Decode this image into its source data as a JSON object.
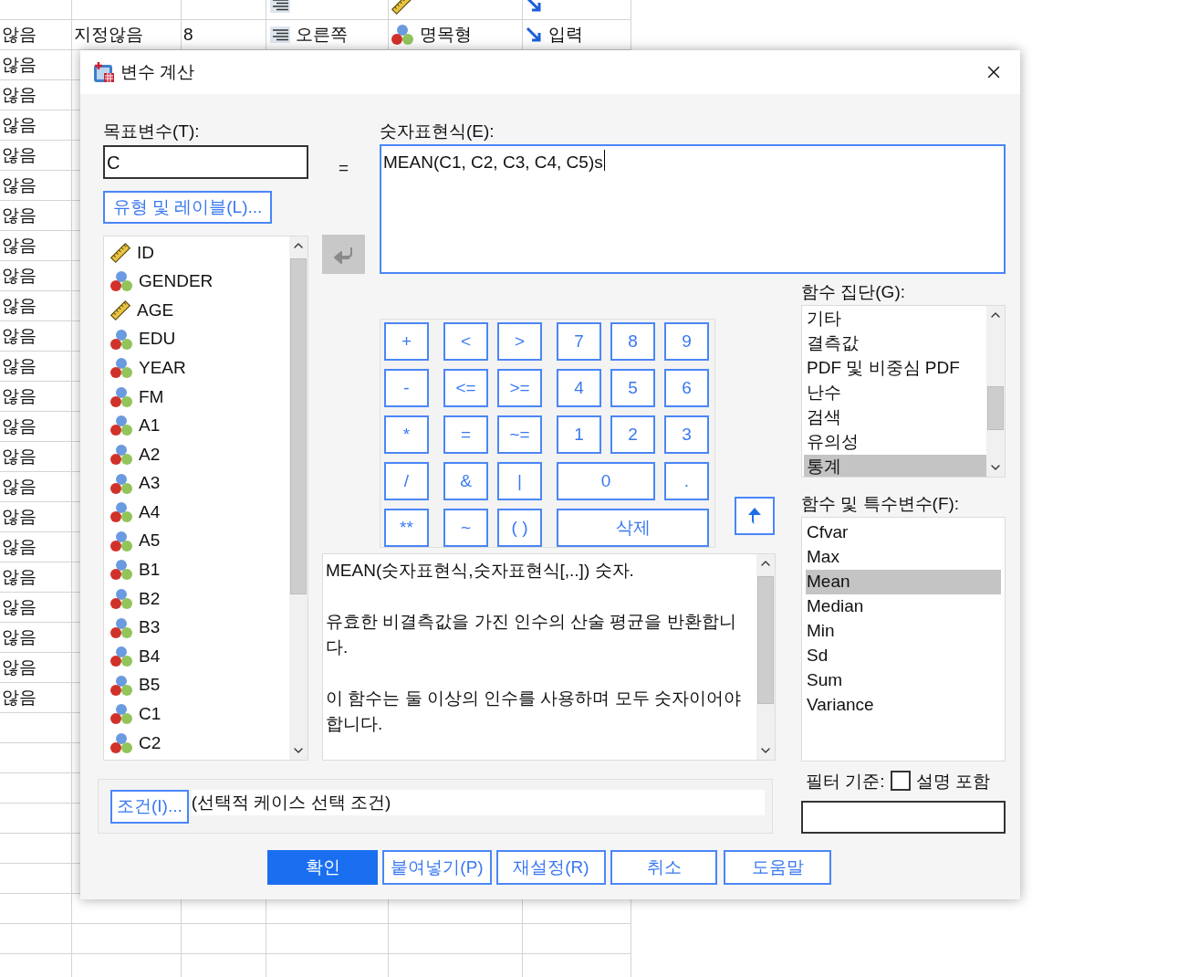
{
  "background_grid": {
    "rows": [
      {
        "kind": "scale"
      },
      {
        "cells": [
          "않음",
          "지정않음",
          "8",
          "오른쪽",
          "명목형",
          "입력"
        ],
        "kind": "nominal"
      },
      {
        "cells": [
          "않음"
        ]
      },
      {
        "cells": [
          "않음"
        ]
      },
      {
        "cells": [
          "않음"
        ]
      },
      {
        "cells": [
          "않음"
        ]
      },
      {
        "cells": [
          "않음"
        ]
      },
      {
        "cells": [
          "않음"
        ]
      },
      {
        "cells": [
          "않음"
        ]
      },
      {
        "cells": [
          "않음"
        ]
      },
      {
        "cells": [
          "않음"
        ]
      },
      {
        "cells": [
          "않음"
        ]
      },
      {
        "cells": [
          "않음"
        ]
      },
      {
        "cells": [
          "않음"
        ]
      },
      {
        "cells": [
          "않음"
        ]
      },
      {
        "cells": [
          "않음"
        ]
      },
      {
        "cells": [
          "않음"
        ]
      },
      {
        "cells": [
          "않음"
        ]
      },
      {
        "cells": [
          "않음"
        ]
      },
      {
        "cells": [
          "않음"
        ]
      },
      {
        "cells": [
          "않음"
        ]
      },
      {
        "cells": [
          "않음"
        ]
      },
      {
        "cells": [
          "않음"
        ]
      },
      {
        "cells": [
          "않음"
        ]
      }
    ]
  },
  "dialog": {
    "title": "변수 계산",
    "target_label": "목표변수(T):",
    "target_value": "C",
    "equals": "=",
    "type_label_button": "유형 및 레이블(L)...",
    "variables": [
      {
        "name": "ID",
        "kind": "scale"
      },
      {
        "name": "GENDER",
        "kind": "nominal"
      },
      {
        "name": "AGE",
        "kind": "scale"
      },
      {
        "name": "EDU",
        "kind": "nominal"
      },
      {
        "name": "YEAR",
        "kind": "nominal"
      },
      {
        "name": "FM",
        "kind": "nominal"
      },
      {
        "name": "A1",
        "kind": "nominal"
      },
      {
        "name": "A2",
        "kind": "nominal"
      },
      {
        "name": "A3",
        "kind": "nominal"
      },
      {
        "name": "A4",
        "kind": "nominal"
      },
      {
        "name": "A5",
        "kind": "nominal"
      },
      {
        "name": "B1",
        "kind": "nominal"
      },
      {
        "name": "B2",
        "kind": "nominal"
      },
      {
        "name": "B3",
        "kind": "nominal"
      },
      {
        "name": "B4",
        "kind": "nominal"
      },
      {
        "name": "B5",
        "kind": "nominal"
      },
      {
        "name": "C1",
        "kind": "nominal"
      },
      {
        "name": "C2",
        "kind": "nominal"
      }
    ],
    "expression_label": "숫자표현식(E):",
    "expression_value": "MEAN(C1, C2, C3, C4, C5)s",
    "keypad": [
      [
        "+",
        "<",
        ">",
        "7",
        "8",
        "9"
      ],
      [
        "-",
        "<=",
        ">=",
        "4",
        "5",
        "6"
      ],
      [
        "*",
        "=",
        "~=",
        "1",
        "2",
        "3"
      ],
      [
        "/",
        "&",
        "|",
        "0",
        "."
      ],
      [
        "**",
        "~",
        "( )",
        "삭제"
      ]
    ],
    "description": [
      "MEAN(숫자표현식,숫자표현식[,..]) 숫자.",
      "유효한 비결측값을 가진 인수의 산술 평균을 반환합니다.",
      "이 함수는 둘 이상의 인수를 사용하며 모두 숫자이어야 합니다."
    ],
    "group_label": "함수 집단(G):",
    "groups": [
      {
        "label": "기타",
        "selected": false
      },
      {
        "label": "결측값",
        "selected": false
      },
      {
        "label": "PDF 및 비중심 PDF",
        "selected": false
      },
      {
        "label": "난수",
        "selected": false
      },
      {
        "label": "검색",
        "selected": false
      },
      {
        "label": "유의성",
        "selected": false
      },
      {
        "label": "통계",
        "selected": true
      }
    ],
    "functions_label": "함수 및 특수변수(F):",
    "functions": [
      {
        "label": "Cfvar",
        "selected": false
      },
      {
        "label": "Max",
        "selected": false
      },
      {
        "label": "Mean",
        "selected": true
      },
      {
        "label": "Median",
        "selected": false
      },
      {
        "label": "Min",
        "selected": false
      },
      {
        "label": "Sd",
        "selected": false
      },
      {
        "label": "Sum",
        "selected": false
      },
      {
        "label": "Variance",
        "selected": false
      }
    ],
    "filter_label": "필터 기준:",
    "include_description": {
      "label": "설명 포함",
      "checked": false
    },
    "condition_button": "조건(I)...",
    "condition_text": "(선택적 케이스 선택 조건)",
    "buttons": [
      {
        "label": "확인",
        "kind": "primary"
      },
      {
        "label": "붙여넣기(P)",
        "kind": "secondary"
      },
      {
        "label": "재설정(R)",
        "kind": "secondary"
      },
      {
        "label": "취소",
        "kind": "secondary"
      },
      {
        "label": "도움말",
        "kind": "secondary"
      }
    ]
  }
}
